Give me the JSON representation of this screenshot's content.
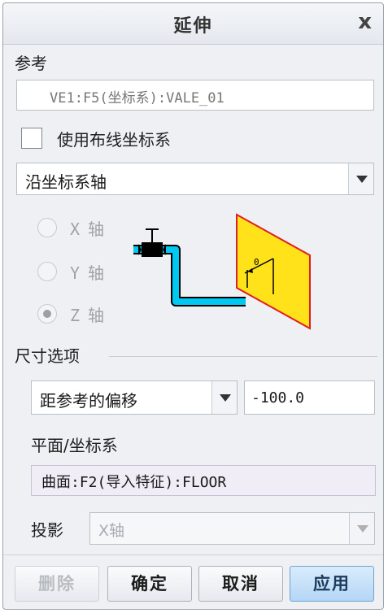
{
  "dialog": {
    "title": "延伸",
    "close_label": "x"
  },
  "reference": {
    "label": "参考",
    "value": "VE1:F5(坐标系):VALE_01"
  },
  "use_routing_csys": {
    "label": "使用布线坐标系",
    "checked": false
  },
  "direction_select": {
    "value": "沿坐标系轴"
  },
  "axis_options": [
    {
      "axis": "X",
      "label": "轴",
      "checked": false
    },
    {
      "axis": "Y",
      "label": "轴",
      "checked": false
    },
    {
      "axis": "Z",
      "label": "轴",
      "checked": true
    }
  ],
  "dimension_options": {
    "group_label": "尺寸选项",
    "mode_select": "距参考的偏移",
    "value": "-100.0",
    "plane_label": "平面/坐标系",
    "plane_value": "曲面:F2(导入特征):FLOOR",
    "projection_label": "投影",
    "projection_value": "X轴"
  },
  "diagram": {
    "dim_label": "0"
  },
  "buttons": {
    "delete": "删除",
    "ok": "确定",
    "cancel": "取消",
    "apply": "应用"
  },
  "colors": {
    "pipe": "#00c8f0",
    "plane_fill": "#ffe21a",
    "plane_edge": "#e02020",
    "primary_button": "#b4d6f5"
  }
}
